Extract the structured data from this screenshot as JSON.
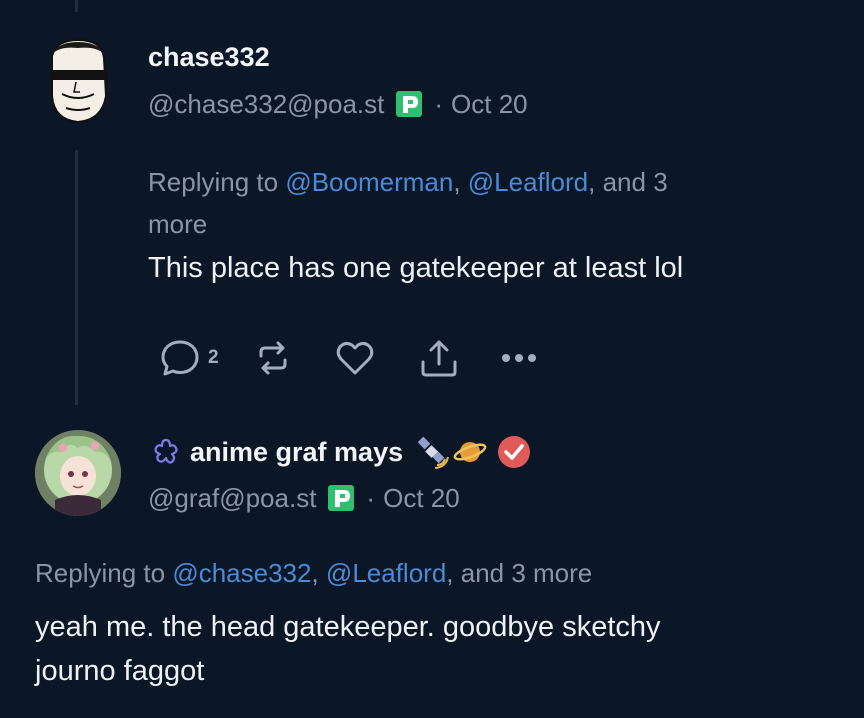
{
  "post1": {
    "display_name": "chase332",
    "handle": "@chase332@poa.st",
    "sep": "·",
    "date": "Oct 20",
    "replying_prefix": "Replying to ",
    "mention1": "@Boomerman",
    "comma": ", ",
    "mention2": "@Leaflord",
    "replying_suffix_1": ", and 3",
    "replying_suffix_2": "more",
    "content": "This place has one gatekeeper at least lol",
    "reply_count": "2"
  },
  "post2": {
    "display_name": "anime graf mays",
    "handle": "@graf@poa.st",
    "sep": "·",
    "date": "Oct 20",
    "replying_prefix": "Replying to ",
    "mention1": "@chase332",
    "comma": ", ",
    "mention2": "@Leaflord",
    "replying_suffix": ", and 3 more",
    "content_line1": "yeah me. the head gatekeeper. goodbye sketchy",
    "content_line2": "journo faggot"
  },
  "icons": {
    "instance_badge": "poast-p-badge-icon",
    "reply": "speech-bubble-icon",
    "repost": "repost-arrows-icon",
    "like": "heart-icon",
    "share": "share-upload-icon",
    "more": "ellipsis-icon",
    "emoji1": "hand-sign-emoji-icon",
    "emoji2": "satellite-emoji-icon",
    "emoji3": "ringed-planet-emoji-icon",
    "verified": "verified-check-icon"
  },
  "colors": {
    "background": "#0b1726",
    "link": "#4b8ad6",
    "muted": "#8a96a8",
    "badge_green": "#2fbf71",
    "verified": "#e15a5a"
  }
}
